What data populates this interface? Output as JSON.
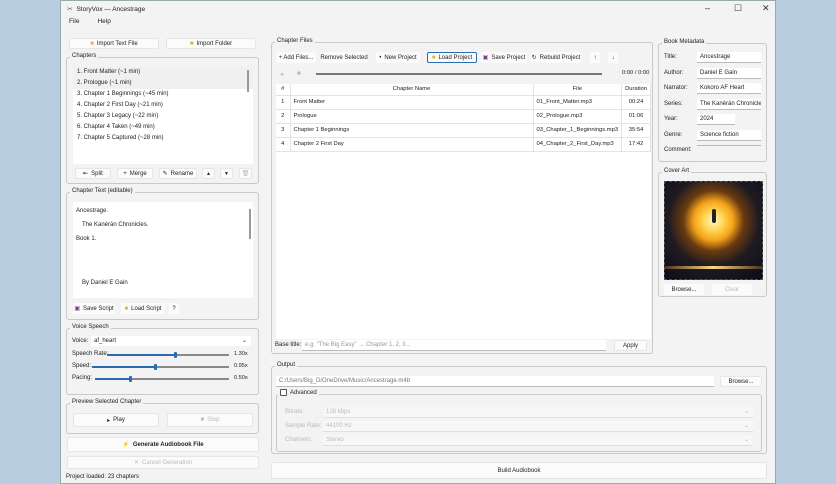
{
  "window": {
    "title": "StoryVox — Ancestrage"
  },
  "menu": [
    "File",
    "Help"
  ],
  "import": {
    "text_file": "Import Text File",
    "folder": "Import Folder"
  },
  "chapters": {
    "title": "Chapters",
    "items": [
      "1. Front Matter  (~1 min)",
      "2. Prologue  (~1 min)",
      "3. Chapter 1 Beginnings  (~45 min)",
      "4. Chapter 2 First Day  (~21 min)",
      "5. Chapter 3 Legacy  (~22 min)",
      "6. Chapter 4 Taken  (~49 min)",
      "7. Chapter 5 Captured  (~28 min)"
    ],
    "selected": 0,
    "buttons": {
      "split": "Split",
      "merge": "Merge",
      "rename": "Rename",
      "up": "▲",
      "down": "▼",
      "delete": "🗑"
    }
  },
  "chapter_text": {
    "title": "Chapter Text (editable)",
    "lines": [
      "Ancestrage.",
      "The Kanérán Chronicles.",
      "Book 1.",
      "By Daniel E Gain"
    ],
    "save": "Save Script",
    "load": "Load Script",
    "help": "?"
  },
  "voice": {
    "title": "Voice  Speech",
    "voice_label": "Voice:",
    "voice_value": "af_heart",
    "sliders": [
      {
        "label": "Speech Rate:",
        "value": "1.30x",
        "fraction": 0.55
      },
      {
        "label": "Speed:",
        "value": "0.95x",
        "fraction": 0.45
      },
      {
        "label": "Pacing:",
        "value": "0.50s",
        "fraction": 0.25
      }
    ]
  },
  "preview": {
    "title": "Preview Selected Chapter",
    "play": "Play",
    "stop": "Stop"
  },
  "generate": "Generate Audiobook File",
  "cancel": "Cancel Generation",
  "status": "Project loaded: 23 chapters",
  "files": {
    "title": "Chapter Files",
    "toolbar": {
      "add": "+ Add Files...",
      "remove": "Remove Selected",
      "new": "New Project",
      "load": "Load Project",
      "save": "Save Project",
      "rebuild": "Rebuild Project",
      "up": "↑",
      "down": "↓"
    },
    "time": "0:00 / 0:00",
    "columns": [
      "#",
      "Chapter Name",
      "File",
      "Duration"
    ],
    "rows": [
      [
        "1",
        "Front Matter",
        "01_Front_Matter.mp3",
        "00:24"
      ],
      [
        "2",
        "Prologue",
        "02_Prologue.mp3",
        "01:06"
      ],
      [
        "3",
        "Chapter 1 Beginnings",
        "03_Chapter_1_Beginnings.mp3",
        "35:54"
      ],
      [
        "4",
        "Chapter 2 First Day",
        "04_Chapter_2_First_Day.mp3",
        "17:42"
      ]
    ],
    "base_title_label": "Base title:",
    "base_title_placeholder": "e.g. \"The Big Easy\" → Chapter 1, 2, 3...",
    "apply": "Apply"
  },
  "output": {
    "title": "Output",
    "path": "C:/Users/Big_D/OneDrive/Music/Ancestrage.m4b",
    "browse": "Browse...",
    "advanced": "Advanced",
    "fields": [
      {
        "label": "Bitrate:",
        "value": "128 kbps"
      },
      {
        "label": "Sample Rate:",
        "value": "44100 Hz"
      },
      {
        "label": "Channels:",
        "value": "Stereo"
      }
    ]
  },
  "build": "Build Audiobook",
  "metadata": {
    "title": "Book Metadata",
    "fields": [
      {
        "label": "Title:",
        "value": "Ancestrage"
      },
      {
        "label": "Author:",
        "value": "Daniel E Gain"
      },
      {
        "label": "Narrator:",
        "value": "Kokoro AF Heart"
      },
      {
        "label": "Series:",
        "value": "The Kanérán Chronicles"
      },
      {
        "label": "Year:",
        "value": "2024"
      },
      {
        "label": "Genre:",
        "value": "Science fiction"
      },
      {
        "label": "Comment:",
        "value": ""
      }
    ]
  },
  "cover": {
    "title": "Cover Art",
    "browse": "Browse...",
    "clear": "Clear"
  },
  "colors": {
    "accent": "#2b6cb0",
    "desktop": "#b9cde0"
  }
}
